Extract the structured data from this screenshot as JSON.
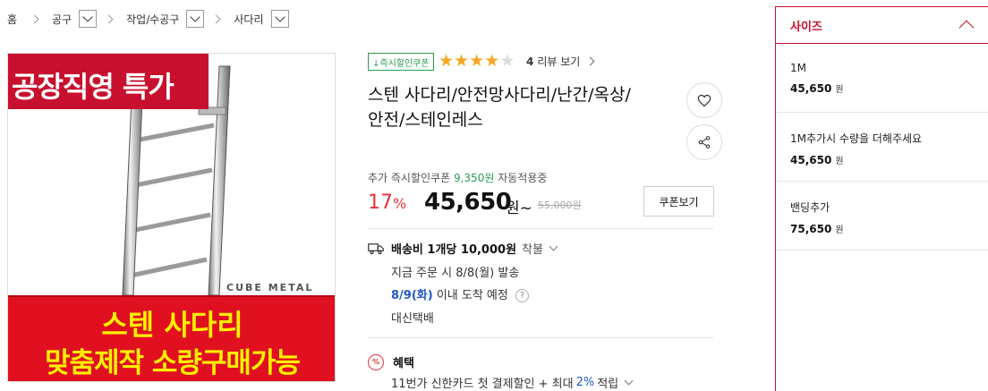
{
  "breadcrumb": {
    "items": [
      {
        "label": "홈"
      },
      {
        "label": "공구"
      },
      {
        "label": "작업/수공구"
      },
      {
        "label": "사다리"
      }
    ]
  },
  "image": {
    "top_banner": "공장직영 특가",
    "brand": "CUBE METAL",
    "bottom_line1": "스텐 사다리",
    "bottom_line2": "맞춤제작 소량구매가능",
    "colors": {
      "banner_red": "#e01020",
      "banner_text": "#fff000"
    }
  },
  "product": {
    "instant_badge": "↓즉시할인쿠폰",
    "rating": 4,
    "rating_max": 5,
    "review_count": "4",
    "review_label": "리뷰 보기",
    "title_line1": "스텐 사다리/안전망사다리/난간/옥상/",
    "title_line2": "안전/스테인레스",
    "heart_icon": "heart-icon",
    "share_icon": "share-icon"
  },
  "price": {
    "coupon_prefix": "추가 즉시할인쿠폰",
    "coupon_amount": "9,350원",
    "coupon_suffix": "자동적용중",
    "discount_pct": "17",
    "discount_unit": "%",
    "sale_price": "45,650",
    "sale_unit": "원~",
    "original_price": "55,000원",
    "coupon_button": "쿠폰보기"
  },
  "shipping": {
    "fee": "배송비 1개당 10,000원",
    "condition": "착불",
    "order_text": "지금 주문 시 8/8(월) 발송",
    "arrival_date": "8/9(화)",
    "arrival_text": "이내 도착 예정",
    "carrier": "대신택배"
  },
  "benefit": {
    "title": "혜택",
    "text_before": "11번가 신한카드 첫 결제할인 + 최대",
    "rate": "2%",
    "text_after": "적립"
  },
  "options": {
    "header": "사이즈",
    "items": [
      {
        "name": "1M",
        "price": "45,650",
        "unit": "원"
      },
      {
        "name": "1M추가시 수량을 더해주세요",
        "price": "45,650",
        "unit": "원"
      },
      {
        "name": "밴딩추가",
        "price": "75,650",
        "unit": "원"
      }
    ],
    "accent": "#c8102e"
  }
}
